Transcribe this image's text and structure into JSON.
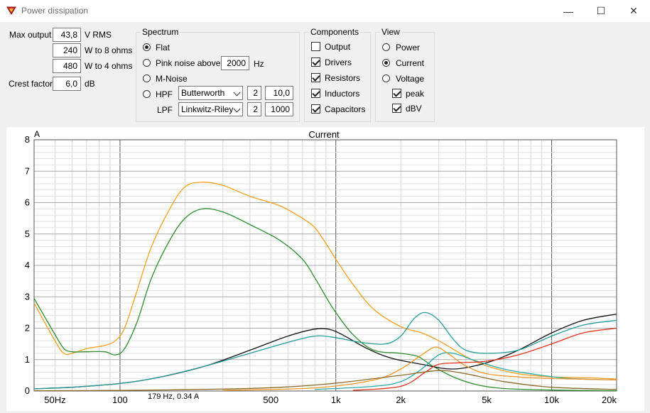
{
  "window": {
    "title": "Power dissipation",
    "minimize": "—",
    "maximize": "☐",
    "close": "✕"
  },
  "output": {
    "max_output_label": "Max output",
    "max_output_value": "43,8",
    "max_output_unit": "V  RMS",
    "w8_value": "240",
    "w8_unit": "W to 8 ohms",
    "w4_value": "480",
    "w4_unit": "W to 4 ohms",
    "crest_label": "Crest factor",
    "crest_value": "6,0",
    "crest_unit": "dB"
  },
  "spectrum": {
    "title": "Spectrum",
    "flat": "Flat",
    "pink": "Pink noise above",
    "pink_value": "2000",
    "pink_unit": "Hz",
    "mnoise": "M-Noise",
    "hpf": "HPF",
    "hpf_type": "Butterworth",
    "hpf_order": "2",
    "hpf_freq": "10,0",
    "lpf": "LPF",
    "lpf_type": "Linkwitz-Riley",
    "lpf_order": "2",
    "lpf_freq": "1000",
    "selected": "flat"
  },
  "components": {
    "title": "Components",
    "output": "Output",
    "output_checked": false,
    "drivers": "Drivers",
    "drivers_checked": true,
    "resistors": "Resistors",
    "resistors_checked": true,
    "inductors": "Inductors",
    "inductors_checked": true,
    "capacitors": "Capacitors",
    "capacitors_checked": true
  },
  "view": {
    "title": "View",
    "power": "Power",
    "current": "Current",
    "voltage": "Voltage",
    "selected": "current",
    "peak": "peak",
    "peak_checked": true,
    "dbv": "dBV",
    "dbv_checked": true
  },
  "chart_data": {
    "type": "line",
    "title": "Current",
    "ylabel": "A",
    "xscale": "log",
    "xlim": [
      40,
      20000
    ],
    "ylim": [
      0,
      8
    ],
    "yticks": [
      0,
      1,
      2,
      3,
      4,
      5,
      6,
      7,
      8
    ],
    "xticks": [
      {
        "value": 50,
        "label": "50Hz"
      },
      {
        "value": 100,
        "label": "100"
      },
      {
        "value": 500,
        "label": "500"
      },
      {
        "value": 1000,
        "label": "1k"
      },
      {
        "value": 2000,
        "label": "2k"
      },
      {
        "value": 5000,
        "label": "5k"
      },
      {
        "value": 10000,
        "label": "10k"
      },
      {
        "value": 20000,
        "label": "20k"
      }
    ],
    "grid": true,
    "cursor_readout": "179 Hz, 0.34 A",
    "series": [
      {
        "color": "#f5a020",
        "points": [
          [
            40,
            2.8
          ],
          [
            50,
            1.6
          ],
          [
            55,
            1.2
          ],
          [
            60,
            1.2
          ],
          [
            70,
            1.35
          ],
          [
            85,
            1.45
          ],
          [
            95,
            1.6
          ],
          [
            105,
            2.0
          ],
          [
            120,
            3.2
          ],
          [
            140,
            4.6
          ],
          [
            170,
            5.8
          ],
          [
            200,
            6.5
          ],
          [
            240,
            6.65
          ],
          [
            300,
            6.55
          ],
          [
            400,
            6.2
          ],
          [
            550,
            5.9
          ],
          [
            700,
            5.5
          ],
          [
            800,
            5.2
          ],
          [
            900,
            4.7
          ],
          [
            1000,
            4.2
          ],
          [
            1200,
            3.4
          ],
          [
            1500,
            2.6
          ],
          [
            2000,
            2.05
          ],
          [
            2500,
            1.85
          ],
          [
            3000,
            1.6
          ],
          [
            4000,
            1.1
          ],
          [
            5000,
            0.8
          ],
          [
            7000,
            0.55
          ],
          [
            10000,
            0.45
          ],
          [
            15000,
            0.42
          ],
          [
            20000,
            0.38
          ]
        ]
      },
      {
        "color": "#2e8b2e",
        "points": [
          [
            40,
            2.95
          ],
          [
            50,
            1.8
          ],
          [
            55,
            1.35
          ],
          [
            60,
            1.25
          ],
          [
            70,
            1.25
          ],
          [
            85,
            1.25
          ],
          [
            95,
            1.15
          ],
          [
            105,
            1.35
          ],
          [
            120,
            2.2
          ],
          [
            140,
            3.6
          ],
          [
            170,
            4.8
          ],
          [
            200,
            5.5
          ],
          [
            240,
            5.8
          ],
          [
            300,
            5.7
          ],
          [
            400,
            5.3
          ],
          [
            550,
            4.8
          ],
          [
            700,
            4.2
          ],
          [
            800,
            3.6
          ],
          [
            900,
            3.0
          ],
          [
            1000,
            2.5
          ],
          [
            1200,
            1.8
          ],
          [
            1500,
            1.3
          ],
          [
            2000,
            1.2
          ],
          [
            2400,
            1.1
          ],
          [
            2800,
            0.8
          ],
          [
            3500,
            0.45
          ],
          [
            4500,
            0.2
          ],
          [
            6000,
            0.08
          ],
          [
            10000,
            0.03
          ],
          [
            20000,
            0.01
          ]
        ]
      },
      {
        "color": "#111111",
        "points": [
          [
            40,
            0.07
          ],
          [
            60,
            0.12
          ],
          [
            100,
            0.24
          ],
          [
            150,
            0.43
          ],
          [
            250,
            0.8
          ],
          [
            400,
            1.3
          ],
          [
            600,
            1.75
          ],
          [
            800,
            1.97
          ],
          [
            950,
            1.95
          ],
          [
            1100,
            1.75
          ],
          [
            1400,
            1.35
          ],
          [
            1800,
            1.05
          ],
          [
            2500,
            0.85
          ],
          [
            3500,
            0.7
          ],
          [
            5000,
            0.9
          ],
          [
            7000,
            1.3
          ],
          [
            10000,
            1.85
          ],
          [
            14000,
            2.25
          ],
          [
            20000,
            2.45
          ]
        ]
      },
      {
        "color": "#2a9b9b",
        "points": [
          [
            40,
            0.07
          ],
          [
            60,
            0.12
          ],
          [
            100,
            0.24
          ],
          [
            150,
            0.43
          ],
          [
            250,
            0.8
          ],
          [
            400,
            1.2
          ],
          [
            600,
            1.55
          ],
          [
            800,
            1.75
          ],
          [
            1000,
            1.7
          ],
          [
            1300,
            1.55
          ],
          [
            1700,
            1.5
          ],
          [
            2000,
            1.75
          ],
          [
            2300,
            2.3
          ],
          [
            2600,
            2.5
          ],
          [
            3000,
            2.25
          ],
          [
            3500,
            1.65
          ],
          [
            4000,
            1.3
          ],
          [
            5000,
            1.2
          ],
          [
            7000,
            1.3
          ],
          [
            10000,
            1.75
          ],
          [
            14000,
            2.1
          ],
          [
            20000,
            2.25
          ]
        ]
      },
      {
        "color": "#2aa8a8",
        "points": [
          [
            800,
            0.05
          ],
          [
            1500,
            0.15
          ],
          [
            2000,
            0.3
          ],
          [
            2500,
            0.7
          ],
          [
            3000,
            1.15
          ],
          [
            3500,
            1.2
          ],
          [
            4500,
            0.95
          ],
          [
            6000,
            0.7
          ],
          [
            8000,
            0.55
          ],
          [
            12000,
            0.4
          ],
          [
            20000,
            0.35
          ]
        ]
      },
      {
        "color": "#f0962a",
        "points": [
          [
            300,
            0.02
          ],
          [
            800,
            0.1
          ],
          [
            1500,
            0.35
          ],
          [
            2000,
            0.7
          ],
          [
            2500,
            1.15
          ],
          [
            2900,
            1.4
          ],
          [
            3300,
            1.2
          ],
          [
            4000,
            0.8
          ],
          [
            5000,
            0.55
          ],
          [
            7000,
            0.45
          ],
          [
            10000,
            0.4
          ],
          [
            20000,
            0.35
          ]
        ]
      },
      {
        "color": "#e03020",
        "points": [
          [
            1200,
            0.02
          ],
          [
            2000,
            0.15
          ],
          [
            2600,
            0.6
          ],
          [
            3000,
            0.85
          ],
          [
            3800,
            0.9
          ],
          [
            5000,
            0.95
          ],
          [
            7000,
            1.15
          ],
          [
            10000,
            1.5
          ],
          [
            14000,
            1.85
          ],
          [
            20000,
            2.0
          ]
        ]
      },
      {
        "color": "#8c6a2a",
        "points": [
          [
            40,
            0.01
          ],
          [
            100,
            0.02
          ],
          [
            300,
            0.06
          ],
          [
            600,
            0.13
          ],
          [
            1000,
            0.25
          ],
          [
            2000,
            0.5
          ],
          [
            3000,
            0.65
          ],
          [
            4000,
            0.55
          ],
          [
            6000,
            0.3
          ],
          [
            10000,
            0.12
          ],
          [
            20000,
            0.05
          ]
        ]
      }
    ]
  }
}
